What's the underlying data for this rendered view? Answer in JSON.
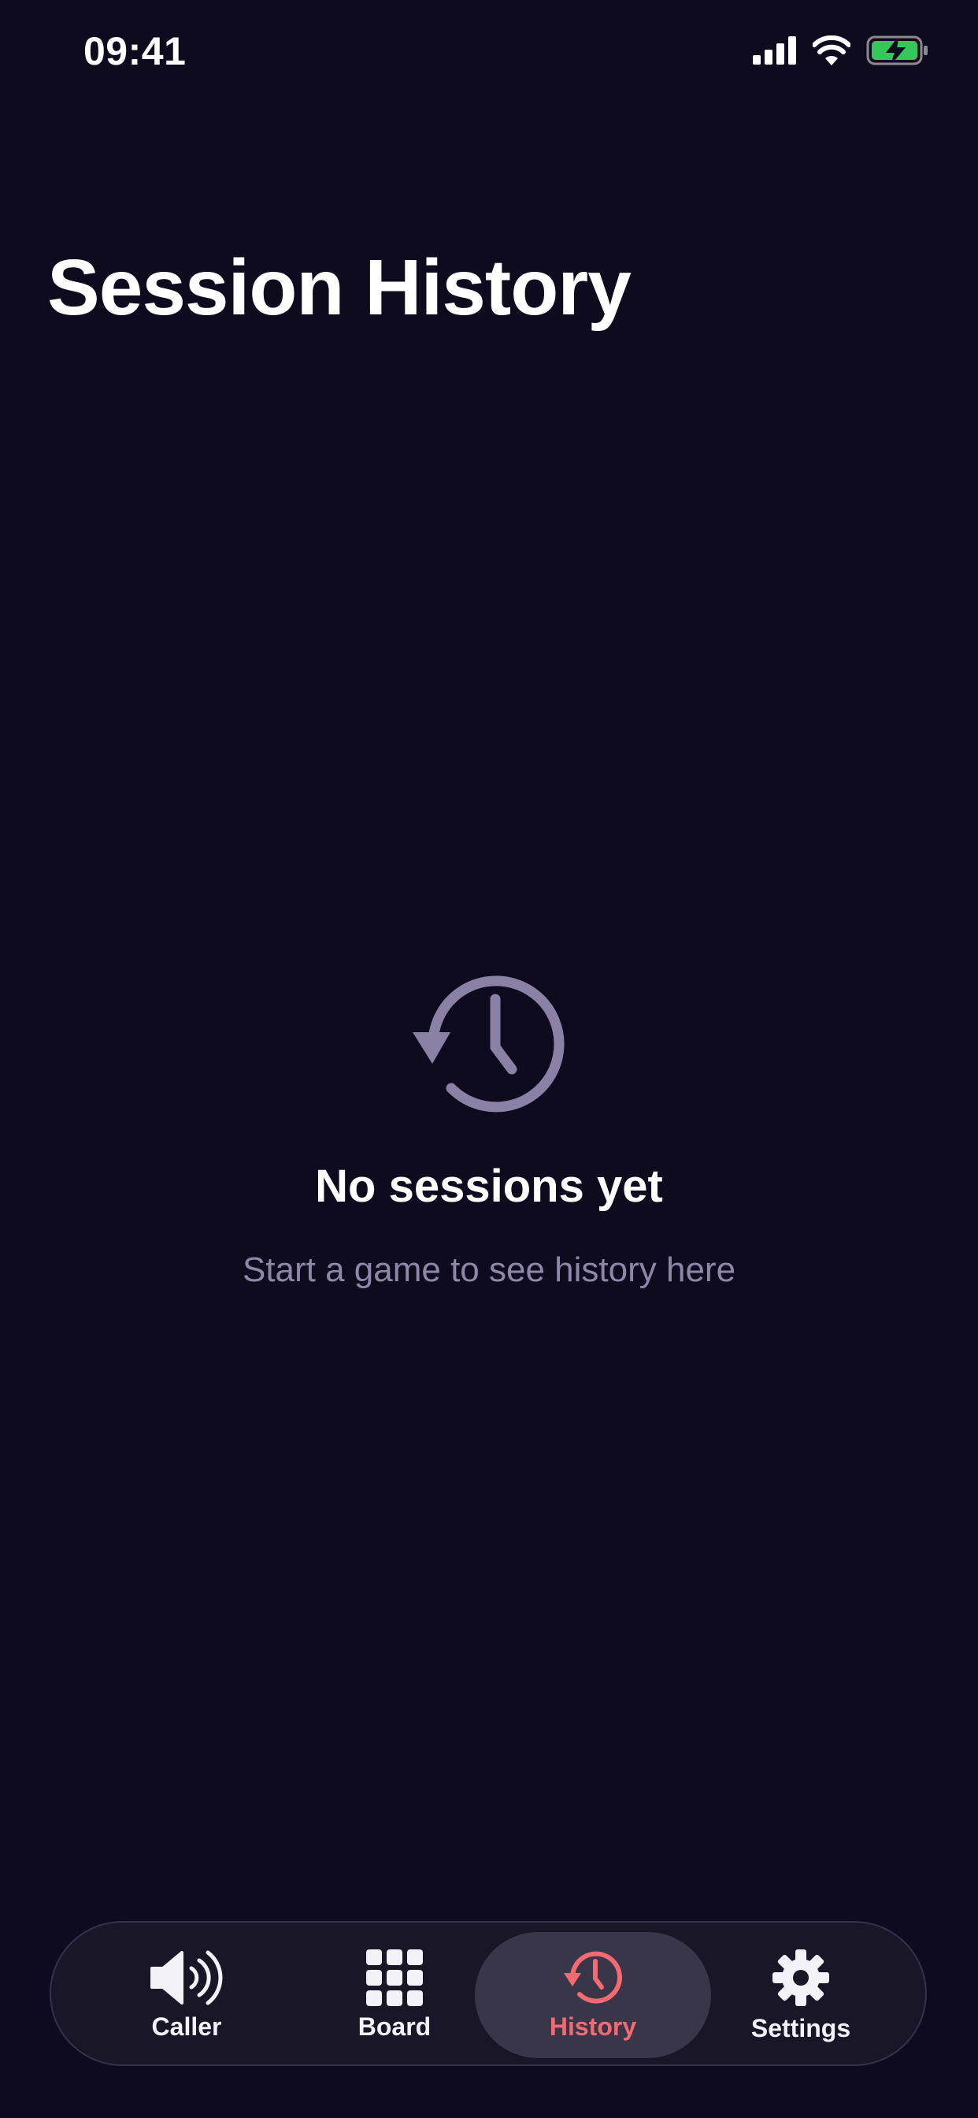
{
  "status_bar": {
    "time": "09:41",
    "icons": [
      "signal-icon",
      "wifi-icon",
      "battery-charging-icon"
    ],
    "battery_color": "#34c759"
  },
  "header": {
    "title": "Session History"
  },
  "empty_state": {
    "icon": "history-icon",
    "title": "No sessions yet",
    "subtitle": "Start a game to see history here"
  },
  "tab_bar": {
    "active": "History",
    "accent_color": "#f26b72",
    "tabs": [
      {
        "label": "Caller",
        "icon": "speaker-icon"
      },
      {
        "label": "Board",
        "icon": "grid-icon"
      },
      {
        "label": "History",
        "icon": "history-icon"
      },
      {
        "label": "Settings",
        "icon": "gear-icon"
      }
    ]
  }
}
